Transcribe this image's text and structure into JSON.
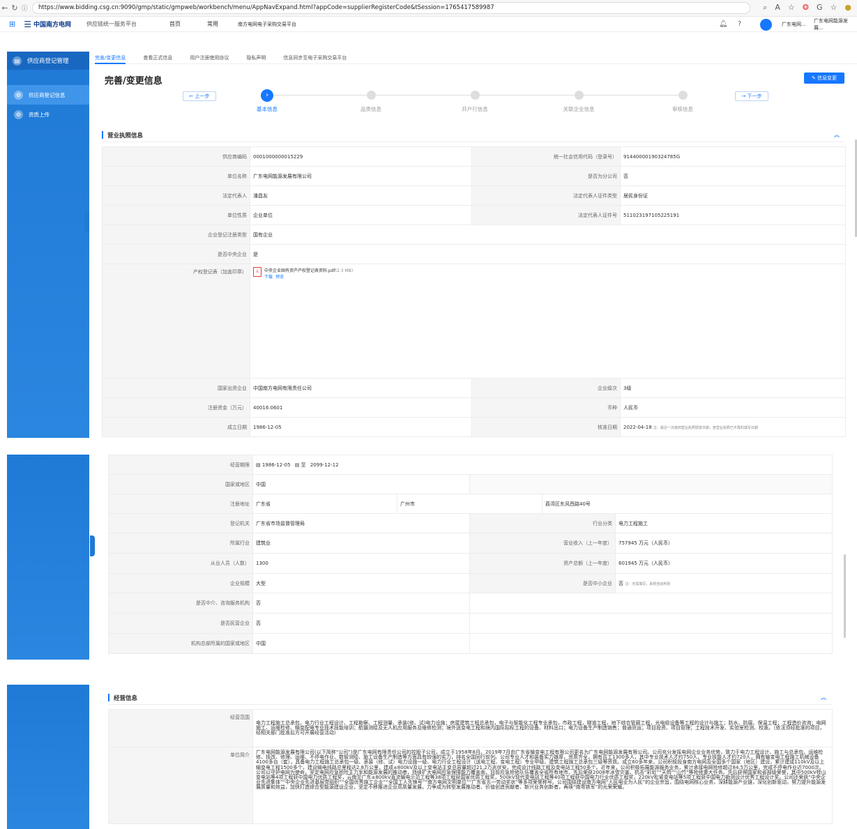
{
  "browser": {
    "url": "https://www.bidding.csg.cn:9090/gmp/static/gmpweb/workbench/menu/AppNavExpand.html?appCode=supplierRegisterCode&tSession=1765417589987",
    "zoom_icon": "search-icon",
    "refresh_icon": "refresh-icon"
  },
  "appbar": {
    "logo_text": "中国南方电网",
    "platform": "供应链统一服务平台",
    "home": "首页",
    "common": "常用",
    "banner": "南方电网电子采购交易平台",
    "user1": "广东电网...",
    "user2": "广东电网能源发展..."
  },
  "sidebar": {
    "module": "供应商登记管理",
    "items": [
      {
        "label": "供应商登记信息"
      },
      {
        "label": "资质上传"
      }
    ]
  },
  "tabs": [
    {
      "label": "完善/变更信息"
    },
    {
      "label": "查看正式信息"
    },
    {
      "label": "用户注册使用协议"
    },
    {
      "label": "隐私声明"
    },
    {
      "label": "信息同步至电子采购交易平台"
    }
  ],
  "page": {
    "title": "完善/变更信息",
    "change_btn": "信息变更",
    "prev": "← 上一步",
    "next": "→ 下一步"
  },
  "steps": [
    {
      "label": "基本信息"
    },
    {
      "label": "品类信息"
    },
    {
      "label": "开户行信息"
    },
    {
      "label": "关联企业信息"
    },
    {
      "label": "审核信息"
    }
  ],
  "license": {
    "heading": "营业执照信息",
    "rows": [
      {
        "l1": "供应商编码",
        "v1": "0001000000015229",
        "l2": "统一社会信用代码（登录号）",
        "v2": "91440000190324785G"
      },
      {
        "l1": "单位名称",
        "v1": "广东电网能源发展有限公司",
        "l2": "是否为分公司",
        "v2": "否"
      },
      {
        "l1": "法定代表人",
        "v1": "潘昌友",
        "l2": "法定代表人证件类型",
        "v2": "居民身份证"
      },
      {
        "l1": "单位性质",
        "v1": "企业单位",
        "l2": "法定代表人证件号",
        "v2": "511023197105225191"
      },
      {
        "l1": "企业登记注册类型",
        "v1": "国有企业"
      },
      {
        "l1": "是否中央企业",
        "v1": "是"
      }
    ],
    "property_label": "产权登记表（加盖印章）",
    "file_name": "中央企业国有资产产权登记表资料.pdf",
    "file_size": "(2.3 MB)",
    "download": "下载",
    "preview": "预览",
    "rows2": [
      {
        "l1": "国家出资企业",
        "v1": "中国南方电网有限责任公司",
        "l2": "企业级次",
        "v2": "3级"
      },
      {
        "l1": "注册资金（万元）",
        "v1": "40016.0601",
        "l2": "币种",
        "v2": "人民币"
      },
      {
        "l1": "成立日期",
        "v1": "1986-12-05",
        "l2": "核准日期",
        "v2": "2022-04-18",
        "n2": "注：最近一次或到营业执照颁发日期，若营业执照已不再的填写日期"
      }
    ]
  },
  "detail": {
    "period_label": "经营期限",
    "period_from_icon": "calendar-icon",
    "period_from": "1986-12-05",
    "period_to_label": "至",
    "period_to": "2099-12-12",
    "country_label": "国家或地区",
    "country": "中国",
    "address_label": "注册地址",
    "province": "广东省",
    "city": "广州市",
    "street": "荔湾区东风西路40号",
    "reg_auth_label": "登记机关",
    "reg_auth": "广东省市场监督管理局",
    "industry_cat_label": "行业分类",
    "industry_cat": "电力工程施工",
    "industry_label": "所属行业",
    "industry": "建筑业",
    "revenue_label": "营业收入（上一年度）",
    "revenue": "757945",
    "revenue_unit": "万元（人民币）",
    "staff_label": "从业人员（人数）",
    "staff": "1300",
    "assets_label": "资产总额（上一年度）",
    "assets": "601945",
    "assets_unit": "万元（人民币）",
    "scale_label": "企业规模",
    "scale": "大型",
    "sme_label": "是否中小企业",
    "sme": "否",
    "sme_note": "注：无需填写，系统自动判别",
    "agency_label": "是否中介、咨询服务机构",
    "agency": "否",
    "private_label": "是否民营企业",
    "private": "否",
    "hq_label": "机构总部所属的国家或地区",
    "hq": "中国"
  },
  "business": {
    "heading": "经营信息",
    "scope_label": "经营范围",
    "scope": "电力工程施工总承包，电力行业工程设计、工程勘察、工程测量、承装(修、试)电力设施；房屋建筑工程总承包，电子与智能化工程专业承包，市政工程，隧道工程，地下综合管廊工程，光电缆设备等工程的设计与施工；防水、防腐、保温工程；工程造价咨询；电网施工、运维检修、输变配电专业技术技能培训；航摄测绘及无人机应用服务及维修检测；境外送变电工程和境内国际招标工程的设备、材料出口；电力设备生产制造销售；普通货运；项目投资、项目管理；工程技术开发、实验室检测、校准。（依法须经批准的项目，经相关部门批准后方可开展经营活动）",
    "intro_label": "单位简介",
    "intro": "广东电网能源发展有限公司(以下简称“公司”)是广东电网有限责任公司的控股子公司，成立于1958年8月。2019年7月由广东省输变电工程有限公司更名为广东电网能源发展有限公司。公司充分发挥电网企业业务优势，致力于电力工程设计、施工与总承包、运维检修、技改、修理、运维、不停电作业、数智测绘、施工设备生产制造等方面具有较强的实力，排名全国同行前列。公司专业人才和装备实力雄厚，资质齐全，拥有员工1300多人，其中专业技术人才约750人，专业技能人才约720人，拥有输变电工程施工机械设备4100多台（套），具备电力工程施工总承包一级、承装（修、试）电力设施一级、电力行业工程设计（送电工程、变电工程）专业甲级、建筑工程施工总承包三级等资质。成立60多年来，公司积极投身南方电网及全国多个国家（地区）建设，累计建成110kV及以上输变电工程1500多个，建设输电线路总里程达2.8万公里，建成±800kV及以上变电站主变总容量超过21.2万兆伏安，完成设计线路工程及变电站工程50多个。近年来，公司积极拓展能源服务业务，累计承接电网抢修超过84.5万公里，完成不停电作业近7000次。公司以守护电网为使命，坚定电网应急抢险主力军和能源发展的推动者，持续扩大电网应急保障能力覆盖面，目前应急抢修队伍覆盖全省所有地市。先后荣获2008年冰雪灾害、抗击“彩虹”“天鸽”“山竹”等抢修重大任务。先后获得国家和省部级荣誉，其中500kV桂山变电站等4项工程获中国电力优质工程奖，云南至广东±800kV直流输电示范工程等38项工程获国家优质工程奖，500kV现代变电站工程等40项工程获中国电力行业优质工程奖，220kV松紧变电站等5项工程获中国电力勘测设计优秀工程设计奖。公司还荣获“中央企业先进集体”“中央企业先进基层党组织”“全国优秀施工企业”“全国工人先锋号”“南方电网文明单位”“广东省五一劳动奖状”等多项荣誉称号。公司围绕建设南方电网“人民电业为人民”的企业宗旨，围绕电网核心业务，深耕能源产业链，深化创新驱动，努力提升能源发展质量和效益，加快打造综合型能源建设企业，坚定不移推进企业高质量发展，力争成为转型发展推动者、价值创造贡献者、新兴业务创新者，再续“南粤铁军”的光荣荣耀。"
  }
}
